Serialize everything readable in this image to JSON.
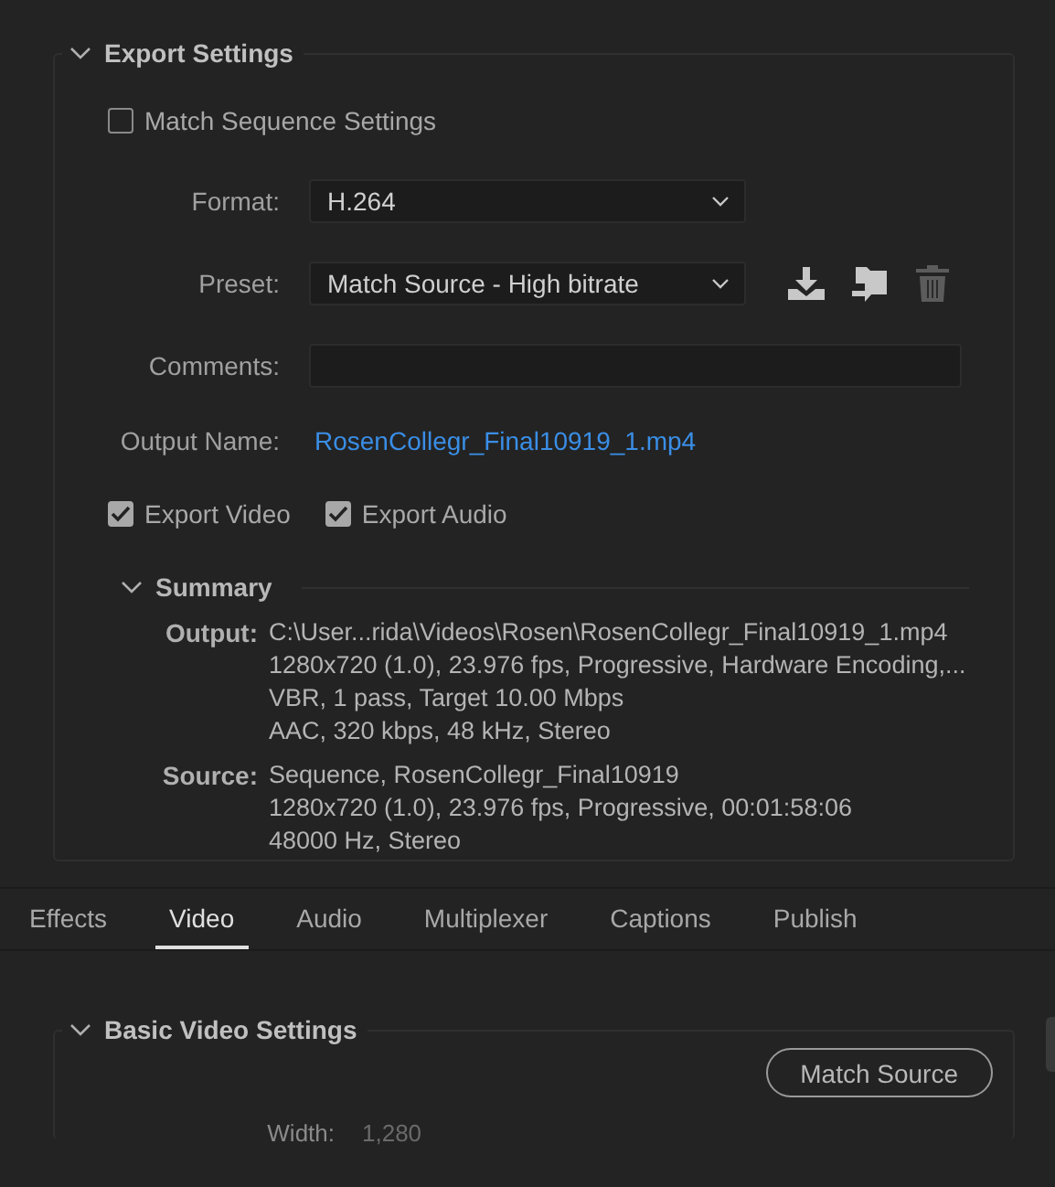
{
  "export_settings": {
    "title": "Export Settings",
    "expanded": true,
    "match_sequence": {
      "label": "Match Sequence Settings",
      "checked": false
    },
    "format": {
      "label": "Format:",
      "value": "H.264"
    },
    "preset": {
      "label": "Preset:",
      "value": "Match Source - High bitrate"
    },
    "comments": {
      "label": "Comments:"
    },
    "output_name": {
      "label": "Output Name:",
      "value": "RosenCollegr_Final10919_1.mp4"
    },
    "export_options": [
      {
        "label": "Export Video",
        "checked": true
      },
      {
        "label": "Export Audio",
        "checked": true
      }
    ],
    "summary": {
      "title": "Summary",
      "expanded": true,
      "entries": [
        {
          "label": "Output:",
          "lines": [
            "C:\\User...rida\\Videos\\Rosen\\RosenCollegr_Final10919_1.mp4",
            "1280x720 (1.0), 23.976 fps, Progressive, Hardware Encoding,...",
            "VBR, 1 pass, Target 10.00 Mbps",
            "AAC, 320 kbps, 48 kHz, Stereo"
          ]
        },
        {
          "label": "Source:",
          "lines": [
            "Sequence, RosenCollegr_Final10919",
            "1280x720 (1.0), 23.976 fps, Progressive, 00:01:58:06",
            "48000 Hz, Stereo"
          ]
        }
      ]
    }
  },
  "tabs": [
    {
      "label": "Effects",
      "selected": false
    },
    {
      "label": "Video",
      "selected": true
    },
    {
      "label": "Audio",
      "selected": false
    },
    {
      "label": "Multiplexer",
      "selected": false
    },
    {
      "label": "Captions",
      "selected": false
    },
    {
      "label": "Publish",
      "selected": false
    }
  ],
  "basic_video_settings": {
    "title": "Basic Video Settings",
    "expanded": true,
    "button": "Match Source",
    "width": {
      "label": "Width:",
      "value": "1,280"
    }
  }
}
